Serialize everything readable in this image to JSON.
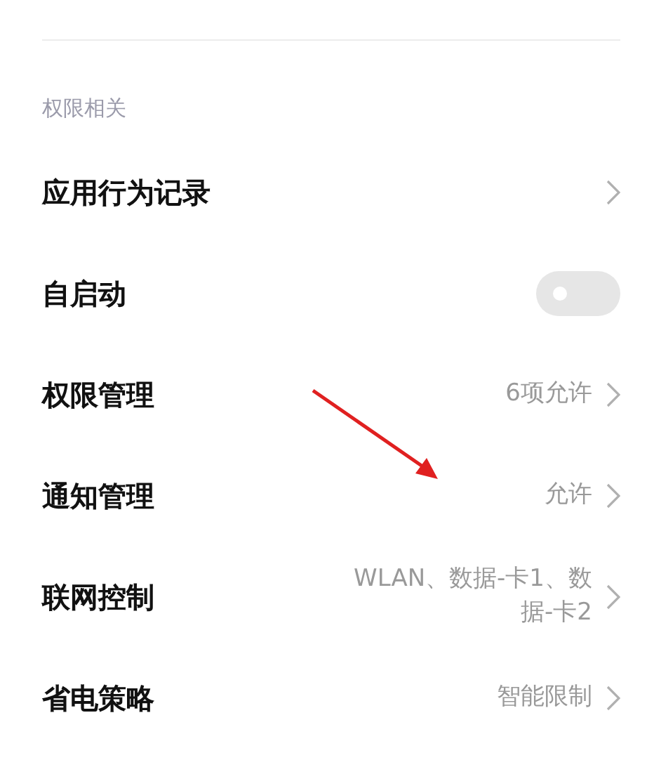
{
  "section": {
    "title": "权限相关"
  },
  "rows": [
    {
      "kind": "link",
      "label": "应用行为记录"
    },
    {
      "kind": "toggle",
      "label": "自启动",
      "on": false
    },
    {
      "kind": "link",
      "label": "权限管理",
      "value": "6项允许"
    },
    {
      "kind": "link",
      "label": "通知管理",
      "value": "允许"
    },
    {
      "kind": "link",
      "label": "联网控制",
      "value": "WLAN、数据-卡1、数据-卡2"
    },
    {
      "kind": "link",
      "label": "省电策略",
      "value": "智能限制"
    }
  ],
  "annotation": {
    "kind": "arrow"
  }
}
